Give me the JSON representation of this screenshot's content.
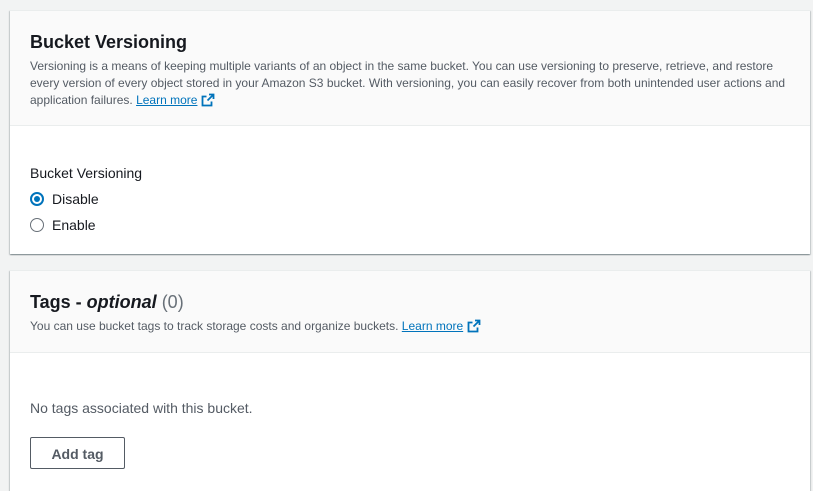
{
  "versioning": {
    "title": "Bucket Versioning",
    "description": "Versioning is a means of keeping multiple variants of an object in the same bucket. You can use versioning to preserve, retrieve, and restore every version of every object stored in your Amazon S3 bucket. With versioning, you can easily recover from both unintended user actions and application failures.",
    "learn_more": "Learn more",
    "field_label": "Bucket Versioning",
    "options": [
      {
        "label": "Disable",
        "selected": true
      },
      {
        "label": "Enable",
        "selected": false
      }
    ]
  },
  "tags": {
    "title_prefix": "Tags - ",
    "title_optional": "optional",
    "count": "(0)",
    "description": "You can use bucket tags to track storage costs and organize buckets.",
    "learn_more": "Learn more",
    "empty_text": "No tags associated with this bucket.",
    "add_button": "Add tag"
  },
  "colors": {
    "link": "#0073bb",
    "radio_selected": "#0073bb",
    "header_bg": "#fafafa",
    "page_bg": "#f2f3f3"
  },
  "icons": {
    "external_link": "external-link-icon"
  }
}
